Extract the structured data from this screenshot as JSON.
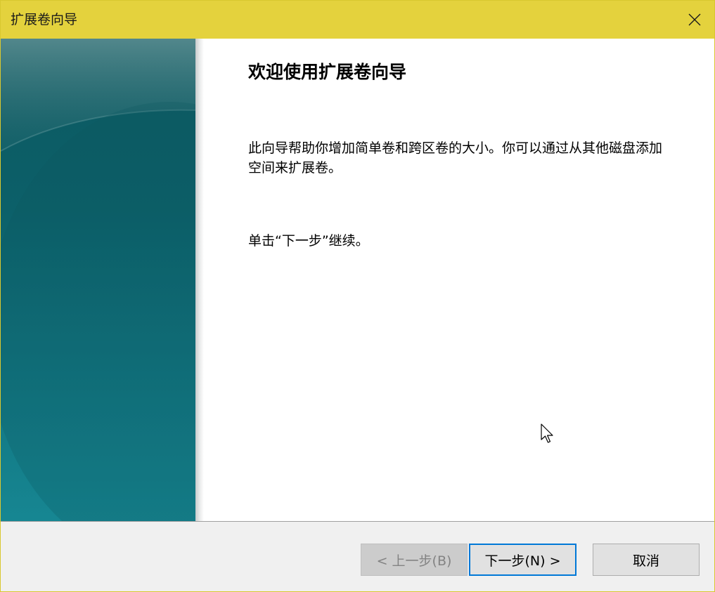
{
  "window": {
    "title": "扩展卷向导"
  },
  "page": {
    "headline": "欢迎使用扩展卷向导",
    "paragraph1": "此向导帮助你增加简单卷和跨区卷的大小。你可以通过从其他磁盘添加空间来扩展卷。",
    "paragraph2": "单击“下一步”继续。"
  },
  "buttons": {
    "back": "< 上一步(B)",
    "next": "下一步(N) >",
    "cancel": "取消"
  },
  "colors": {
    "titlebar": "#e4d23d",
    "banner_top": "#0d5a62",
    "banner_bottom": "#137f8c",
    "focus_border": "#0078d7"
  },
  "icons": {
    "close": "close-icon",
    "cursor": "mouse-pointer-icon"
  }
}
